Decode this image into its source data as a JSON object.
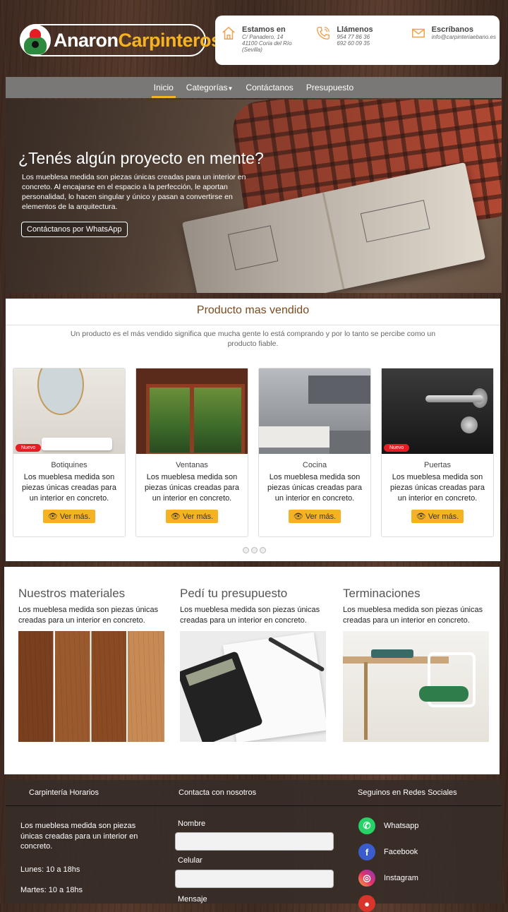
{
  "brand": {
    "name_part1": "Anaron",
    "name_part2": "Carpinteros."
  },
  "contact": {
    "address": {
      "title": "Estamos en",
      "lines": [
        "C/ Panadero, 14",
        "41100 Coria del Río",
        "(Sevilla)"
      ]
    },
    "phone": {
      "title": "Llámenos",
      "lines": [
        "954 77 86 36",
        "692 60 09 35"
      ]
    },
    "email": {
      "title": "Escríbanos",
      "lines": [
        "info@carpinteriaebano.es"
      ]
    }
  },
  "nav": {
    "items": [
      "Inicio",
      "Categorías",
      "Contáctanos",
      "Presupuesto"
    ],
    "active": "Inicio"
  },
  "hero": {
    "title": "¿Tenés algún proyecto en mente?",
    "text": "Los mueblesa medida son piezas únicas creadas para un interior en concreto. Al encajarse en el espacio a la perfección, le aportan personalidad, lo hacen singular y único y pasan a convertirse en elementos de la arquitectura.",
    "button": "Contáctanos por WhatsApp"
  },
  "best_seller": {
    "title": "Producto mas vendido",
    "description": "Un producto es el más vendido significa que mucha gente lo está comprando y por lo tanto se percibe como un producto fiable.",
    "badge_label": "Nuevo",
    "button_label": "Ver más.",
    "products": [
      {
        "name": "Botiquines",
        "description": "Los mueblesa medida son piezas únicas creadas para un interior en concreto.",
        "is_new": true
      },
      {
        "name": "Ventanas",
        "description": "Los mueblesa medida son piezas únicas creadas para un interior en concreto.",
        "is_new": false
      },
      {
        "name": "Cocina",
        "description": "Los mueblesa medida son piezas únicas creadas para un interior en concreto.",
        "is_new": false
      },
      {
        "name": "Puertas",
        "description": "Los mueblesa medida son piezas únicas creadas para un interior en concreto.",
        "is_new": true
      }
    ]
  },
  "features": [
    {
      "title": "Nuestros materiales",
      "text": "Los mueblesa medida son piezas únicas creadas para un interior en concreto."
    },
    {
      "title": "Pedí tu presupuesto",
      "text": "Los mueblesa medida son piezas únicas creadas para un interior en concreto."
    },
    {
      "title": "Terminaciones",
      "text": "Los mueblesa medida son piezas únicas creadas para un interior en concreto."
    }
  ],
  "footer": {
    "hours_title": "Carpintería Horarios",
    "contact_title": "Contacta con nosotros",
    "social_title": "Seguinos en Redes Sociales",
    "text": "Los mueblesa medida son piezas únicas creadas para un interior en concreto.",
    "hours": [
      "Lunes: 10 a 18hs",
      "Martes: 10 a 18hs"
    ],
    "form": {
      "name_label": "Nombre",
      "phone_label": "Celular",
      "message_label": "Mensaje"
    },
    "social": [
      "Whatsapp",
      "Facebook",
      "Instagram"
    ]
  },
  "colors": {
    "accent": "#f5b323",
    "brand_red": "#e31e24",
    "title_brown": "#7b4a1d",
    "nav_bg": "#7a7876"
  }
}
